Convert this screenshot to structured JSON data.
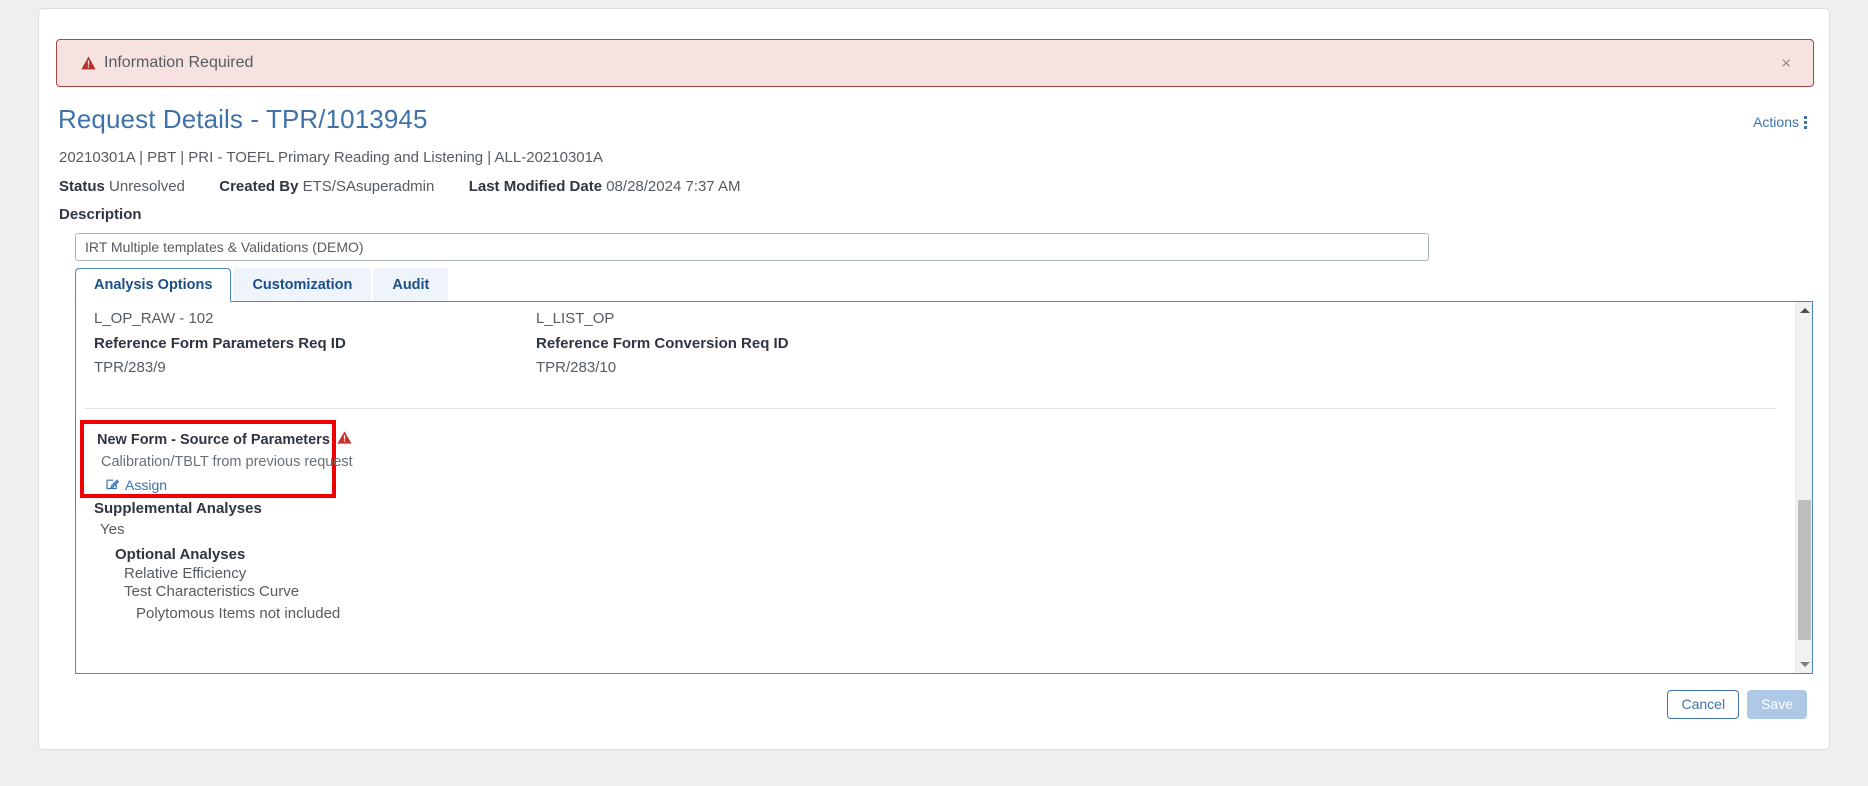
{
  "alert": {
    "icon": "warning-triangle-icon",
    "message": "Information Required",
    "close_label": "×",
    "bg_color": "#f7e2e2",
    "border_color": "#a94442",
    "icon_color": "#b7312c"
  },
  "header": {
    "title": "Request Details - TPR/1013945",
    "title_color": "#3f72ab",
    "subtitle": "20210301A | PBT | PRI - TOEFL Primary Reading and Listening | ALL-20210301A",
    "actions_label": "Actions",
    "actions_icon": "kebab-menu-icon",
    "meta": {
      "status_label": "Status",
      "status_value": "Unresolved",
      "created_by_label": "Created By",
      "created_by_value": "ETS/SAsuperadmin",
      "last_modified_label": "Last Modified Date",
      "last_modified_value": "08/28/2024 7:37 AM"
    }
  },
  "description": {
    "label": "Description",
    "value": "IRT Multiple templates & Validations (DEMO)",
    "placeholder": "Description"
  },
  "tabs": [
    {
      "label": "Analysis Options",
      "active": true
    },
    {
      "label": "Customization",
      "active": false
    },
    {
      "label": "Audit",
      "active": false
    }
  ],
  "panel": {
    "left_column": {
      "top_value": "L_OP_RAW - 102",
      "field_label": "Reference Form Parameters Req ID",
      "field_value": "TPR/283/9"
    },
    "right_column": {
      "top_value": "L_LIST_OP",
      "field_label": "Reference Form Conversion Req ID",
      "field_value": "TPR/283/10"
    },
    "highlight": {
      "border_color": "#f00000",
      "title": "New Form - Source of Parameters",
      "warning_icon": "warning-triangle-icon",
      "value": "Calibration/TBLT from previous request",
      "assign_label": "Assign",
      "assign_icon": "edit-pencil-square-icon"
    },
    "supplemental": {
      "label": "Supplemental Analyses",
      "value": "Yes",
      "optional_label": "Optional Analyses",
      "options": [
        "Relative Efficiency",
        "Test Characteristics Curve"
      ],
      "note": "Polytomous Items not included"
    }
  },
  "footer": {
    "cancel_label": "Cancel",
    "save_label": "Save",
    "save_disabled": true
  }
}
